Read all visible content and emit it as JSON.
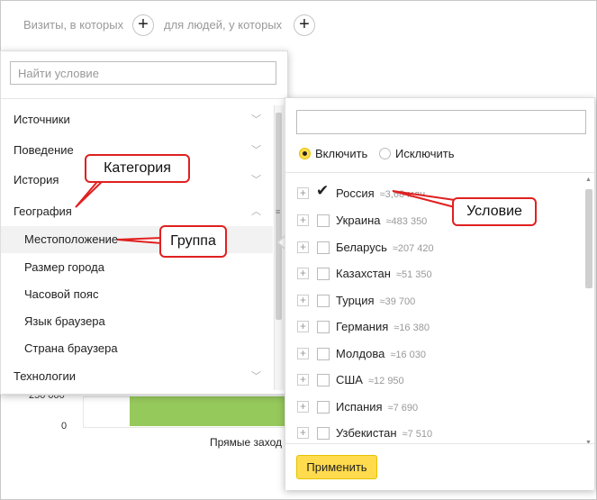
{
  "topbar": {
    "visits_label": "Визиты, в которых",
    "people_label": "для людей, у которых",
    "plus_glyph": "+"
  },
  "chart_bg": {
    "axis_labels": [
      "250 000",
      "0"
    ],
    "bar_caption": "Прямые заход"
  },
  "left_panel": {
    "search_placeholder": "Найти условие",
    "categories": [
      {
        "label": "Источники"
      },
      {
        "label": "Поведение"
      },
      {
        "label": "История"
      },
      {
        "label": "География"
      },
      {
        "label": "Технологии"
      }
    ],
    "groups": [
      {
        "label": "Местоположение"
      },
      {
        "label": "Размер города"
      },
      {
        "label": "Часовой пояс"
      },
      {
        "label": "Язык браузера"
      },
      {
        "label": "Страна браузера"
      }
    ]
  },
  "right_panel": {
    "search_value": "",
    "include_label": "Включить",
    "exclude_label": "Исключить",
    "countries": [
      {
        "name": "Россия",
        "count": "≈3,68 млн",
        "checked": true
      },
      {
        "name": "Украина",
        "count": "≈483 350",
        "checked": false
      },
      {
        "name": "Беларусь",
        "count": "≈207 420",
        "checked": false
      },
      {
        "name": "Казахстан",
        "count": "≈51 350",
        "checked": false
      },
      {
        "name": "Турция",
        "count": "≈39 700",
        "checked": false
      },
      {
        "name": "Германия",
        "count": "≈16 380",
        "checked": false
      },
      {
        "name": "Молдова",
        "count": "≈16 030",
        "checked": false
      },
      {
        "name": "США",
        "count": "≈12 950",
        "checked": false
      },
      {
        "name": "Испания",
        "count": "≈7 690",
        "checked": false
      },
      {
        "name": "Узбекистан",
        "count": "≈7 510",
        "checked": false
      }
    ],
    "apply_label": "Применить"
  },
  "annotations": {
    "category": "Категория",
    "group": "Группа",
    "condition": "Условие"
  },
  "colors": {
    "accent_yellow": "#ffdb4d",
    "callout_red": "#e02020",
    "bar_green": "#8bc34a"
  }
}
